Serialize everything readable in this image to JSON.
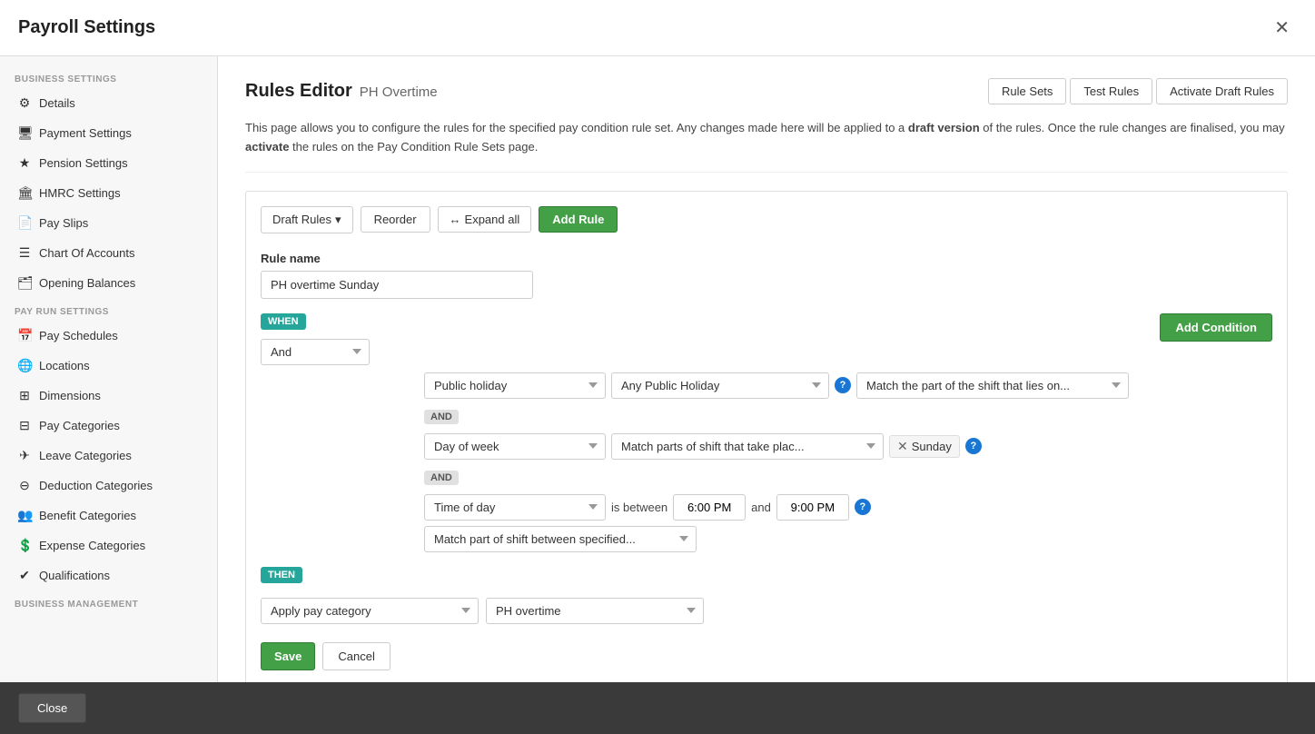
{
  "modal": {
    "title": "Payroll Settings",
    "close_icon": "✕"
  },
  "sidebar": {
    "business_settings_label": "BUSINESS SETTINGS",
    "pay_run_settings_label": "PAY RUN SETTINGS",
    "business_management_label": "BUSINESS MANAGEMENT",
    "items": [
      {
        "id": "details",
        "label": "Details",
        "icon": "⚙"
      },
      {
        "id": "payment-settings",
        "label": "Payment Settings",
        "icon": "🖥"
      },
      {
        "id": "pension-settings",
        "label": "Pension Settings",
        "icon": "★"
      },
      {
        "id": "hmrc-settings",
        "label": "HMRC Settings",
        "icon": "🏛"
      },
      {
        "id": "pay-slips",
        "label": "Pay Slips",
        "icon": "📄"
      },
      {
        "id": "chart-of-accounts",
        "label": "Chart Of Accounts",
        "icon": "☰"
      },
      {
        "id": "opening-balances",
        "label": "Opening Balances",
        "icon": "🗂"
      }
    ],
    "pay_run_items": [
      {
        "id": "pay-schedules",
        "label": "Pay Schedules",
        "icon": "📅"
      },
      {
        "id": "locations",
        "label": "Locations",
        "icon": "🌐"
      },
      {
        "id": "dimensions",
        "label": "Dimensions",
        "icon": "⊞"
      },
      {
        "id": "pay-categories",
        "label": "Pay Categories",
        "icon": "⊟"
      },
      {
        "id": "leave-categories",
        "label": "Leave Categories",
        "icon": "✈"
      },
      {
        "id": "deduction-categories",
        "label": "Deduction Categories",
        "icon": "⊖"
      },
      {
        "id": "benefit-categories",
        "label": "Benefit Categories",
        "icon": "👥"
      },
      {
        "id": "expense-categories",
        "label": "Expense Categories",
        "icon": "💲"
      },
      {
        "id": "qualifications",
        "label": "Qualifications",
        "icon": "✔"
      }
    ]
  },
  "main": {
    "page_title": "Rules Editor",
    "page_subtitle": "PH Overtime",
    "btn_rule_sets": "Rule Sets",
    "btn_test_rules": "Test Rules",
    "btn_activate": "Activate Draft Rules",
    "info_text_1": "This page allows you to configure the rules for the specified pay condition rule set. Any changes made here will be applied to a ",
    "info_bold_1": "draft version",
    "info_text_2": " of the rules. Once the rule changes are finalised, you may ",
    "info_bold_2": "activate",
    "info_text_3": " the rules on the Pay Condition Rule Sets page.",
    "toolbar": {
      "draft_rules": "Draft Rules",
      "reorder": "Reorder",
      "expand_all": "Expand all",
      "add_rule": "Add Rule"
    },
    "rule": {
      "name_label": "Rule name",
      "name_value": "PH overtime Sunday",
      "when_badge": "WHEN",
      "then_badge": "THEN",
      "and_badge": "AND",
      "and_connector_label": "And",
      "condition1_type": "Public holiday",
      "condition1_value": "Any Public Holiday",
      "condition1_match": "Match the part of the shift that lies on...",
      "condition2_type": "Day of week",
      "condition2_value": "Match parts of shift that take plac...",
      "condition2_tag": "Sunday",
      "condition3_type": "Time of day",
      "condition3_between": "is between",
      "condition3_from": "6:00 PM",
      "condition3_and": "and",
      "condition3_to": "9:00 PM",
      "condition3_match": "Match part of shift between specified...",
      "add_condition": "Add Condition",
      "apply_pay_category": "Apply pay category",
      "ph_overtime": "PH overtime",
      "save": "Save",
      "cancel": "Cancel"
    }
  },
  "footer": {
    "close_label": "Close"
  }
}
